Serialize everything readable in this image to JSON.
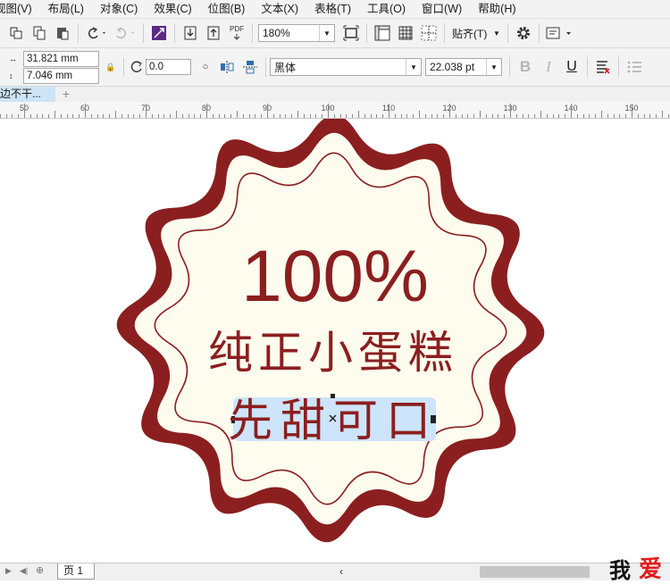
{
  "menu": [
    "视图(V)",
    "布局(L)",
    "对象(C)",
    "效果(C)",
    "位图(B)",
    "文本(X)",
    "表格(T)",
    "工具(O)",
    "窗口(W)",
    "帮助(H)"
  ],
  "toolbar1": {
    "zoom": "180%",
    "snap_label": "贴齐(T)",
    "pdf_label": "PDF"
  },
  "toolbar2": {
    "width": "31.821 mm",
    "height": "7.046 mm",
    "rotation": "0.0",
    "font_name": "黑体",
    "font_size": "22.038 pt",
    "bold_label": "B",
    "italic_label": "I",
    "underline_label": "U"
  },
  "doc_tab": {
    "label": "边不干...",
    "add_label": "+"
  },
  "ruler": {
    "labels": [
      "50",
      "60",
      "70",
      "80",
      "90",
      "100",
      "110",
      "120",
      "130",
      "140",
      "150"
    ]
  },
  "badge": {
    "line1": "100%",
    "line2": "纯正小蛋糕",
    "line3": "先甜可口",
    "colors": {
      "outer": "#8b1f1f",
      "fill": "#fdfcee",
      "text": "#8b1f1f",
      "selection": "#cde4fa"
    }
  },
  "bottom": {
    "page_tab": "页 1"
  },
  "watermark": {
    "char1": "我",
    "char2": "爱"
  }
}
